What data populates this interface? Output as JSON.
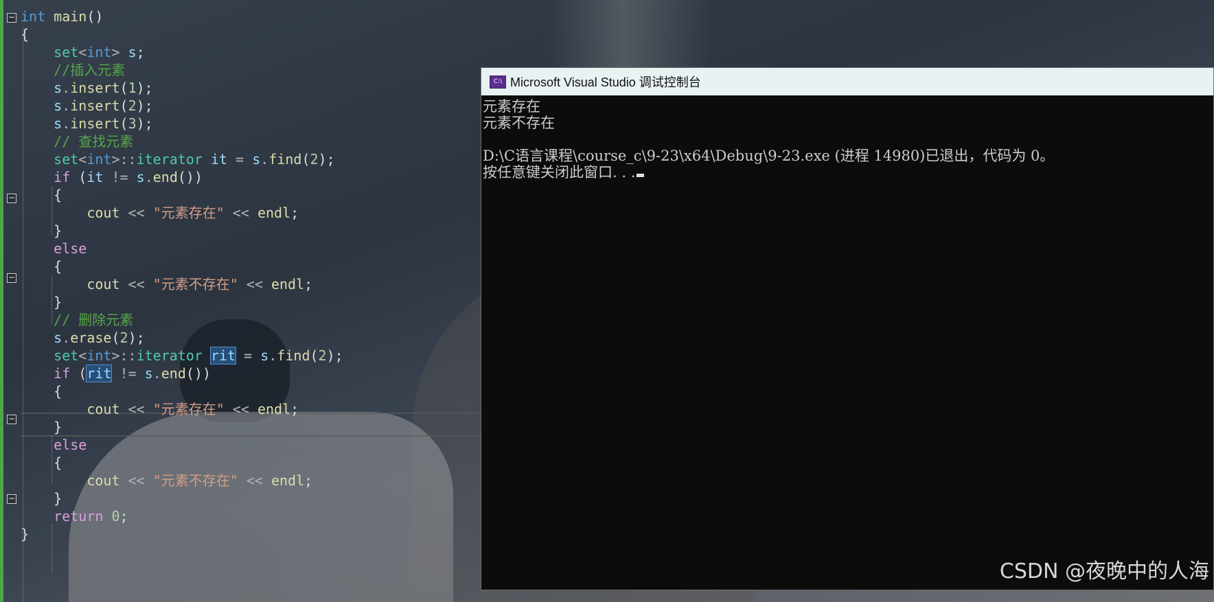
{
  "editor": {
    "lines": [
      {
        "tokens": [
          [
            "kw",
            "int"
          ],
          [
            "",
            " "
          ],
          [
            "fn",
            "main"
          ],
          [
            "",
            "()"
          ]
        ]
      },
      {
        "tokens": [
          [
            "",
            "{"
          ]
        ]
      },
      {
        "tokens": [
          [
            "",
            "    "
          ],
          [
            "typ",
            "set"
          ],
          [
            "op",
            "<"
          ],
          [
            "kw",
            "int"
          ],
          [
            "op",
            ">"
          ],
          [
            "",
            " "
          ],
          [
            "var",
            "s"
          ],
          [
            "",
            ";"
          ]
        ]
      },
      {
        "tokens": [
          [
            "",
            "    "
          ],
          [
            "cmt",
            "//插入元素"
          ]
        ]
      },
      {
        "tokens": [
          [
            "",
            "    "
          ],
          [
            "var",
            "s"
          ],
          [
            "op",
            "."
          ],
          [
            "fn",
            "insert"
          ],
          [
            "",
            "("
          ],
          [
            "num",
            "1"
          ],
          [
            "",
            ");"
          ]
        ]
      },
      {
        "tokens": [
          [
            "",
            "    "
          ],
          [
            "var",
            "s"
          ],
          [
            "op",
            "."
          ],
          [
            "fn",
            "insert"
          ],
          [
            "",
            "("
          ],
          [
            "num",
            "2"
          ],
          [
            "",
            ");"
          ]
        ]
      },
      {
        "tokens": [
          [
            "",
            "    "
          ],
          [
            "var",
            "s"
          ],
          [
            "op",
            "."
          ],
          [
            "fn",
            "insert"
          ],
          [
            "",
            "("
          ],
          [
            "num",
            "3"
          ],
          [
            "",
            ");"
          ]
        ]
      },
      {
        "tokens": [
          [
            "",
            "    "
          ],
          [
            "cmt",
            "// 查找元素"
          ]
        ]
      },
      {
        "tokens": [
          [
            "",
            "    "
          ],
          [
            "typ",
            "set"
          ],
          [
            "op",
            "<"
          ],
          [
            "kw",
            "int"
          ],
          [
            "op",
            ">::"
          ],
          [
            "typ",
            "iterator"
          ],
          [
            "",
            " "
          ],
          [
            "var",
            "it"
          ],
          [
            "",
            " "
          ],
          [
            "op",
            "="
          ],
          [
            "",
            " "
          ],
          [
            "var",
            "s"
          ],
          [
            "op",
            "."
          ],
          [
            "fn",
            "find"
          ],
          [
            "",
            "("
          ],
          [
            "num",
            "2"
          ],
          [
            "",
            ");"
          ]
        ]
      },
      {
        "tokens": [
          [
            "",
            "    "
          ],
          [
            "ctl",
            "if"
          ],
          [
            "",
            " ("
          ],
          [
            "var",
            "it"
          ],
          [
            "",
            " "
          ],
          [
            "op",
            "!="
          ],
          [
            "",
            " "
          ],
          [
            "var",
            "s"
          ],
          [
            "op",
            "."
          ],
          [
            "fn",
            "end"
          ],
          [
            "",
            "())"
          ]
        ]
      },
      {
        "tokens": [
          [
            "",
            "    {"
          ]
        ]
      },
      {
        "tokens": [
          [
            "",
            "        "
          ],
          [
            "fn",
            "cout"
          ],
          [
            "",
            " "
          ],
          [
            "op",
            "<<"
          ],
          [
            "",
            " "
          ],
          [
            "str",
            "\"元素存在\""
          ],
          [
            "",
            " "
          ],
          [
            "op",
            "<<"
          ],
          [
            "",
            " "
          ],
          [
            "fn",
            "endl"
          ],
          [
            "",
            ";"
          ]
        ]
      },
      {
        "tokens": [
          [
            "",
            "    }"
          ]
        ]
      },
      {
        "tokens": [
          [
            "",
            "    "
          ],
          [
            "ctl",
            "else"
          ]
        ]
      },
      {
        "tokens": [
          [
            "",
            "    {"
          ]
        ]
      },
      {
        "tokens": [
          [
            "",
            "        "
          ],
          [
            "fn",
            "cout"
          ],
          [
            "",
            " "
          ],
          [
            "op",
            "<<"
          ],
          [
            "",
            " "
          ],
          [
            "str",
            "\"元素不存在\""
          ],
          [
            "",
            " "
          ],
          [
            "op",
            "<<"
          ],
          [
            "",
            " "
          ],
          [
            "fn",
            "endl"
          ],
          [
            "",
            ";"
          ]
        ]
      },
      {
        "tokens": [
          [
            "",
            "    }"
          ]
        ]
      },
      {
        "tokens": [
          [
            "",
            "    "
          ],
          [
            "cmt",
            "// 删除元素"
          ]
        ]
      },
      {
        "tokens": [
          [
            "",
            "    "
          ],
          [
            "var",
            "s"
          ],
          [
            "op",
            "."
          ],
          [
            "fn",
            "erase"
          ],
          [
            "",
            "("
          ],
          [
            "num",
            "2"
          ],
          [
            "",
            ");"
          ]
        ]
      },
      {
        "tokens": [
          [
            "",
            "    "
          ],
          [
            "typ",
            "set"
          ],
          [
            "op",
            "<"
          ],
          [
            "kw",
            "int"
          ],
          [
            "op",
            ">::"
          ],
          [
            "typ",
            "iterator"
          ],
          [
            "",
            " "
          ],
          [
            "var hl",
            "rit"
          ],
          [
            "",
            " "
          ],
          [
            "op",
            "="
          ],
          [
            "",
            " "
          ],
          [
            "var",
            "s"
          ],
          [
            "op",
            "."
          ],
          [
            "fn",
            "find"
          ],
          [
            "",
            "("
          ],
          [
            "num",
            "2"
          ],
          [
            "",
            ");"
          ]
        ]
      },
      {
        "tokens": [
          [
            "",
            "    "
          ],
          [
            "ctl",
            "if"
          ],
          [
            "",
            " ("
          ],
          [
            "var hl",
            "rit"
          ],
          [
            "",
            " "
          ],
          [
            "op",
            "!="
          ],
          [
            "",
            " "
          ],
          [
            "var",
            "s"
          ],
          [
            "op",
            "."
          ],
          [
            "fn",
            "end"
          ],
          [
            "",
            "())"
          ]
        ]
      },
      {
        "tokens": [
          [
            "",
            "    {"
          ]
        ]
      },
      {
        "tokens": [
          [
            "",
            "        "
          ],
          [
            "fn",
            "cout"
          ],
          [
            "",
            " "
          ],
          [
            "op",
            "<<"
          ],
          [
            "",
            " "
          ],
          [
            "str",
            "\"元素存在\""
          ],
          [
            "",
            " "
          ],
          [
            "op",
            "<<"
          ],
          [
            "",
            " "
          ],
          [
            "fn",
            "endl"
          ],
          [
            "",
            ";"
          ]
        ]
      },
      {
        "tokens": [
          [
            "",
            "    }"
          ]
        ]
      },
      {
        "tokens": [
          [
            "",
            "    "
          ],
          [
            "ctl",
            "else"
          ]
        ]
      },
      {
        "tokens": [
          [
            "",
            "    {"
          ]
        ]
      },
      {
        "tokens": [
          [
            "",
            "        "
          ],
          [
            "fn",
            "cout"
          ],
          [
            "",
            " "
          ],
          [
            "op",
            "<<"
          ],
          [
            "",
            " "
          ],
          [
            "str",
            "\"元素不存在\""
          ],
          [
            "",
            " "
          ],
          [
            "op",
            "<<"
          ],
          [
            "",
            " "
          ],
          [
            "fn",
            "endl"
          ],
          [
            "",
            ";"
          ]
        ]
      },
      {
        "tokens": [
          [
            "",
            "    }"
          ]
        ]
      },
      {
        "tokens": [
          [
            "",
            "    "
          ],
          [
            "ctl",
            "return"
          ],
          [
            "",
            " "
          ],
          [
            "num",
            "0"
          ],
          [
            "",
            ";"
          ]
        ]
      },
      {
        "tokens": [
          [
            "",
            "}"
          ]
        ]
      }
    ],
    "fold_markers": [
      "−",
      "−",
      "−",
      "−",
      "−"
    ]
  },
  "console": {
    "icon_text": "C:\\",
    "title": "Microsoft Visual Studio 调试控制台",
    "lines": [
      "元素存在",
      "元素不存在",
      "",
      "D:\\C语言课程\\course_c\\9-23\\x64\\Debug\\9-23.exe (进程 14980)已退出，代码为 0。",
      "按任意键关闭此窗口. . ."
    ]
  },
  "watermark": "CSDN @夜晚中的人海",
  "colors": {
    "keyword": "#569cd6",
    "control": "#d8a0df",
    "type": "#4ec9b0",
    "variable": "#9cdcfe",
    "function": "#dcdcaa",
    "number": "#b5cea8",
    "string": "#d69d85",
    "comment": "#57a64a",
    "console_bg": "#0c0c0c",
    "titlebar_bg": "#e9f2f3"
  }
}
